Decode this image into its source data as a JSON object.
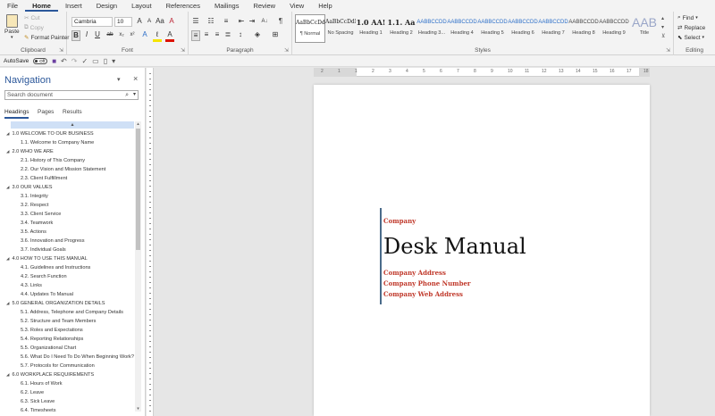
{
  "menu": {
    "items": [
      "File",
      "Home",
      "Insert",
      "Design",
      "Layout",
      "References",
      "Mailings",
      "Review",
      "View",
      "Help"
    ],
    "active": "Home"
  },
  "ribbon": {
    "clipboard": {
      "label": "Clipboard",
      "paste": "Paste",
      "cut": "Cut",
      "copy": "Copy",
      "format_painter": "Format Painter"
    },
    "font": {
      "label": "Font",
      "name": "Cambria",
      "size": "10"
    },
    "paragraph": {
      "label": "Paragraph"
    },
    "styles": {
      "label": "Styles",
      "items": [
        {
          "preview": "AaBbCcDdE",
          "name": "¶ Normal"
        },
        {
          "preview": "AaBbCcDdE",
          "name": "No Spacing"
        },
        {
          "preview": "1.0 AA!",
          "name": "Heading 1"
        },
        {
          "preview": "1.1. Aa",
          "name": "Heading 2"
        },
        {
          "preview": "AABBCCDD",
          "name": "Heading 3..."
        },
        {
          "preview": "AABBCCDD",
          "name": "Heading 4"
        },
        {
          "preview": "AABBCCDD",
          "name": "Heading 5"
        },
        {
          "preview": "AABBCCDD",
          "name": "Heading 6"
        },
        {
          "preview": "AABBCCDD",
          "name": "Heading 7"
        },
        {
          "preview": "AABBCCDD",
          "name": "Heading 8"
        },
        {
          "preview": "AABBCCDD",
          "name": "Heading 9"
        },
        {
          "preview": "AAB",
          "name": "Title"
        }
      ]
    },
    "editing": {
      "label": "Editing",
      "find": "Find",
      "replace": "Replace",
      "select": "Select"
    }
  },
  "qat": {
    "autosave": "AutoSave",
    "toggle": "Off"
  },
  "nav": {
    "title": "Navigation",
    "search_placeholder": "Search document",
    "tabs": [
      "Headings",
      "Pages",
      "Results"
    ],
    "items": [
      {
        "text": "1.0 WELCOME TO OUR BUSINESS",
        "level": 1
      },
      {
        "text": "1.1. Welcome to Company Name",
        "level": 2
      },
      {
        "text": "2.0 WHO WE ARE",
        "level": 1
      },
      {
        "text": "2.1. History of This Company",
        "level": 2
      },
      {
        "text": "2.2. Our Vision and Mission Statement",
        "level": 2
      },
      {
        "text": "2.3. Client Fulfillment",
        "level": 2
      },
      {
        "text": "3.0 OUR VALUES",
        "level": 1
      },
      {
        "text": "3.1. Integrity",
        "level": 2
      },
      {
        "text": "3.2. Respect",
        "level": 2
      },
      {
        "text": "3.3. Client Service",
        "level": 2
      },
      {
        "text": "3.4. Teamwork",
        "level": 2
      },
      {
        "text": "3.5. Actions",
        "level": 2
      },
      {
        "text": "3.6. Innovation and Progress",
        "level": 2
      },
      {
        "text": "3.7. Individual Goals",
        "level": 2
      },
      {
        "text": "4.0 HOW TO USE THIS MANUAL",
        "level": 1
      },
      {
        "text": "4.1. Guidelines and Instructions",
        "level": 2
      },
      {
        "text": "4.2. Search Function",
        "level": 2
      },
      {
        "text": "4.3. Links",
        "level": 2
      },
      {
        "text": "4.4. Updates To Manual",
        "level": 2
      },
      {
        "text": "5.0 GENERAL ORGANIZATION DETAILS",
        "level": 1
      },
      {
        "text": "5.1. Address, Telephone and Company Details",
        "level": 2
      },
      {
        "text": "5.2. Structure and Team Members",
        "level": 2
      },
      {
        "text": "5.3. Roles and Expectations",
        "level": 2
      },
      {
        "text": "5.4. Reporting Relationships",
        "level": 2
      },
      {
        "text": "5.5. Organizational Chart",
        "level": 2
      },
      {
        "text": "5.6. What Do I Need To Do When Beginning Work?",
        "level": 2
      },
      {
        "text": "5.7. Protocols for Communication",
        "level": 2
      },
      {
        "text": "6.0 WORKPLACE REQUIREMENTS",
        "level": 1
      },
      {
        "text": "6.1. Hours of Work",
        "level": 2
      },
      {
        "text": "6.2. Leave",
        "level": 2
      },
      {
        "text": "6.3. Sick Leave",
        "level": 2
      },
      {
        "text": "6.4. Timesheets",
        "level": 2
      }
    ]
  },
  "ruler": {
    "marks": [
      "2",
      "1",
      "1",
      "2",
      "3",
      "4",
      "5",
      "6",
      "7",
      "8",
      "9",
      "10",
      "11",
      "12",
      "13",
      "14",
      "15",
      "16",
      "17",
      "18"
    ]
  },
  "document": {
    "company": "Company",
    "title": "Desk Manual",
    "address": "Company Address",
    "phone": "Company Phone Number",
    "web": "Company Web Address"
  },
  "colors": {
    "accent": "#2b579a",
    "cover_red": "#c0392b",
    "cover_line": "#4a6b8a",
    "nav_selection": "#cfe0f6"
  }
}
